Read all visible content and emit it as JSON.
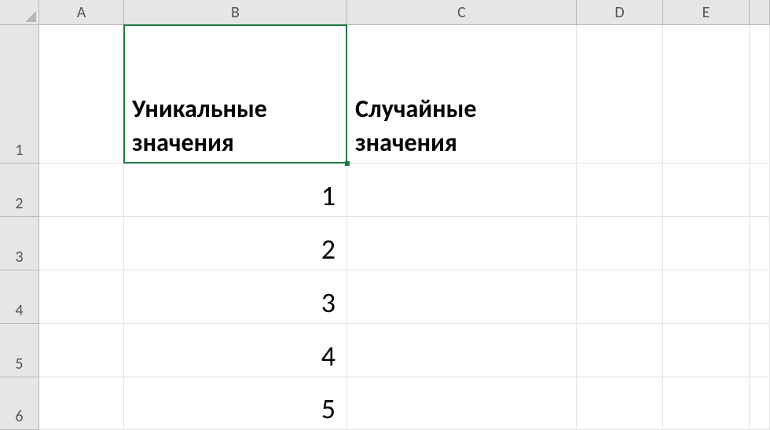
{
  "columns": [
    "A",
    "B",
    "C",
    "D",
    "E"
  ],
  "rows": [
    "1",
    "2",
    "3",
    "4",
    "5",
    "6"
  ],
  "headers": {
    "b1": "Уникальные\nзначения",
    "c1": "Случайные\nзначения"
  },
  "values": {
    "b2": "1",
    "b3": "2",
    "b4": "3",
    "b5": "4",
    "b6": "5"
  },
  "selection": {
    "cell": "B1"
  }
}
